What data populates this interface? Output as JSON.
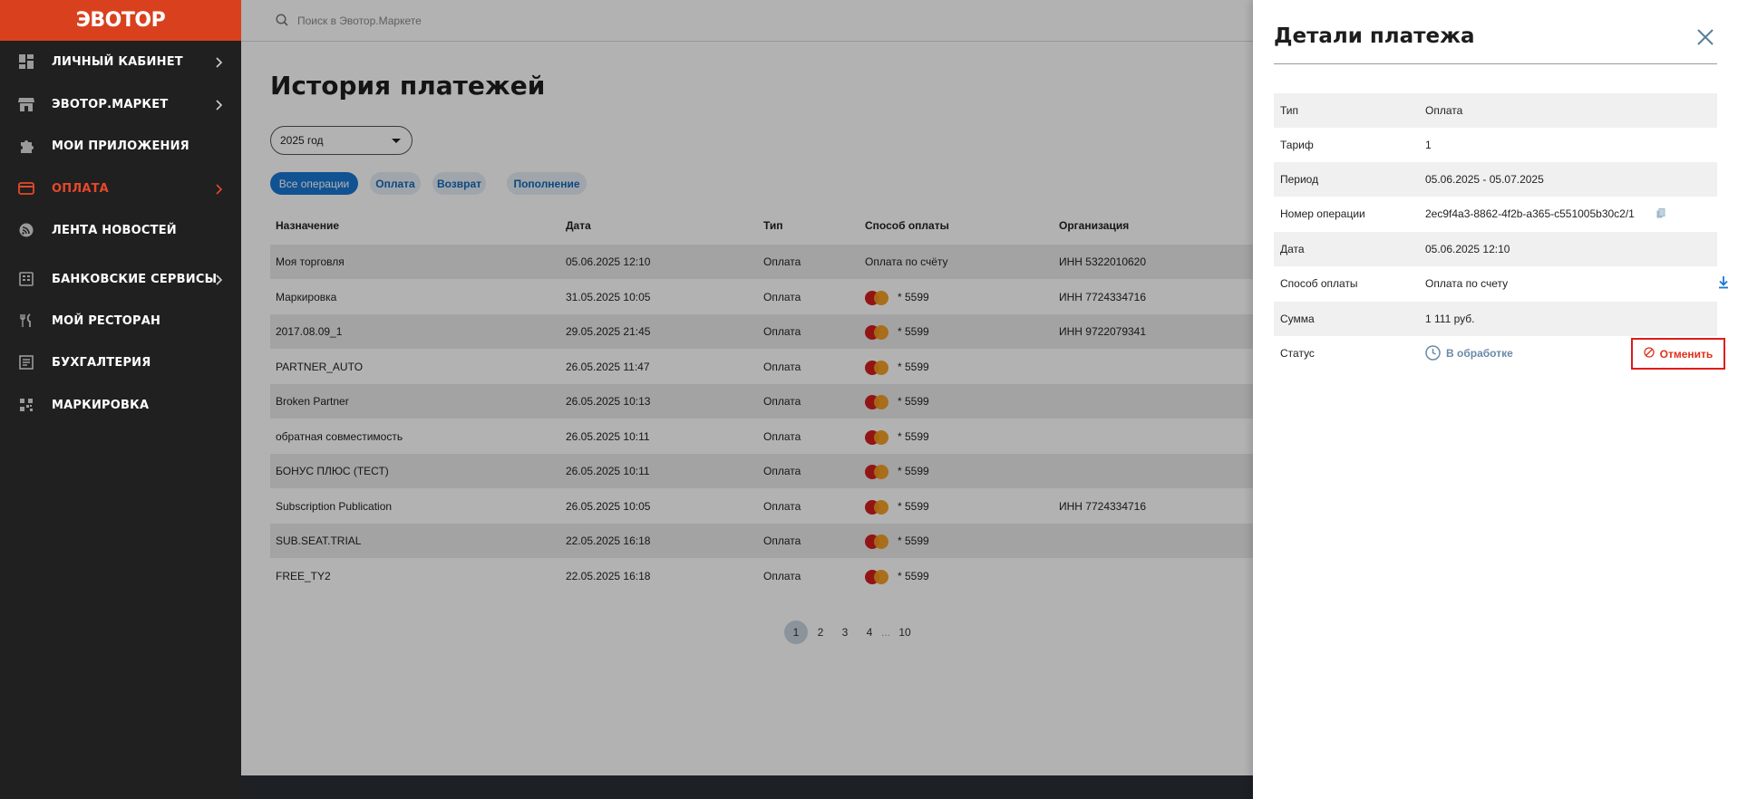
{
  "brand": {
    "logo_text": "ЭВОТОР"
  },
  "sidebar": {
    "items": [
      {
        "label": "ЛИЧНЫЙ КАБИНЕТ",
        "icon": "dashboard-icon",
        "chevron": true,
        "active": false
      },
      {
        "label": "ЭВОТОР.МАРКЕТ",
        "icon": "store-icon",
        "chevron": true,
        "active": false
      },
      {
        "label": "МОИ ПРИЛОЖЕНИЯ",
        "icon": "puzzle-icon",
        "chevron": false,
        "active": false
      },
      {
        "label": "ОПЛАТА",
        "icon": "card-icon",
        "chevron": true,
        "active": true
      },
      {
        "label": "ЛЕНТА НОВОСТЕЙ",
        "icon": "news-icon",
        "chevron": false,
        "active": false
      },
      {
        "label": "БАНКОВСКИЕ СЕРВИСЫ",
        "icon": "bank-icon",
        "chevron": true,
        "active": false
      },
      {
        "label": "МОЙ РЕСТОРАН",
        "icon": "cutlery-icon",
        "chevron": false,
        "active": false
      },
      {
        "label": "БУХГАЛТЕРИЯ",
        "icon": "ledger-icon",
        "chevron": false,
        "active": false
      },
      {
        "label": "МАРКИРОВКА",
        "icon": "barcode-icon",
        "chevron": false,
        "active": false
      }
    ]
  },
  "search": {
    "placeholder": "Поиск в Эвотор.Маркете"
  },
  "main": {
    "title": "История платежей",
    "year_select": "2025 год",
    "filters": [
      "Все операции",
      "Оплата",
      "Возврат",
      "Пополнение"
    ],
    "columns": [
      "Назначение",
      "Дата",
      "Тип",
      "Способ оплаты",
      "Организация"
    ],
    "rows": [
      {
        "purpose": "Моя торговля",
        "date": "05.06.2025 12:10",
        "type": "Оплата",
        "method": "Оплата по счёту",
        "card": false,
        "org": "ИНН 5322010620"
      },
      {
        "purpose": "Маркировка",
        "date": "31.05.2025 10:05",
        "type": "Оплата",
        "method": "* 5599",
        "card": true,
        "org": "ИНН 7724334716"
      },
      {
        "purpose": "2017.08.09_1",
        "date": "29.05.2025 21:45",
        "type": "Оплата",
        "method": "* 5599",
        "card": true,
        "org": "ИНН 9722079341"
      },
      {
        "purpose": "PARTNER_AUTO",
        "date": "26.05.2025 11:47",
        "type": "Оплата",
        "method": "* 5599",
        "card": true,
        "org": ""
      },
      {
        "purpose": "Broken Partner",
        "date": "26.05.2025 10:13",
        "type": "Оплата",
        "method": "* 5599",
        "card": true,
        "org": ""
      },
      {
        "purpose": "обратная совместимость",
        "date": "26.05.2025 10:11",
        "type": "Оплата",
        "method": "* 5599",
        "card": true,
        "org": ""
      },
      {
        "purpose": "БОНУС ПЛЮС (ТЕСТ)",
        "date": "26.05.2025 10:11",
        "type": "Оплата",
        "method": "* 5599",
        "card": true,
        "org": ""
      },
      {
        "purpose": "Subscription Publication",
        "date": "26.05.2025 10:05",
        "type": "Оплата",
        "method": "* 5599",
        "card": true,
        "org": "ИНН 7724334716"
      },
      {
        "purpose": "SUB.SEAT.TRIAL",
        "date": "22.05.2025 16:18",
        "type": "Оплата",
        "method": "* 5599",
        "card": true,
        "org": ""
      },
      {
        "purpose": "FREE_TY2",
        "date": "22.05.2025 16:18",
        "type": "Оплата",
        "method": "* 5599",
        "card": true,
        "org": ""
      }
    ],
    "pagination": {
      "pages": [
        "1",
        "2",
        "3",
        "4"
      ],
      "ellipsis": "...",
      "last": "10",
      "current": "1"
    }
  },
  "details": {
    "title": "Детали платежа",
    "rows": [
      {
        "label": "Тип",
        "value": "Оплата"
      },
      {
        "label": "Тариф",
        "value": "1"
      },
      {
        "label": "Период",
        "value": "05.06.2025 - 05.07.2025"
      },
      {
        "label": "Номер операции",
        "value": "2ec9f4a3-8862-4f2b-a365-c551005b30c2/1"
      },
      {
        "label": "Дата",
        "value": "05.06.2025 12:10"
      },
      {
        "label": "Способ оплаты",
        "value": "Оплата по счету"
      },
      {
        "label": "Сумма",
        "value": "1 111 руб."
      },
      {
        "label": "Статус",
        "value": "В обработке"
      }
    ],
    "cancel_label": "Отменить"
  },
  "colors": {
    "brand": "#d9411e",
    "active_nav": "#e5482a",
    "primary": "#1976d2",
    "status": "#6a8aa8",
    "cancel": "#e01b1b"
  }
}
